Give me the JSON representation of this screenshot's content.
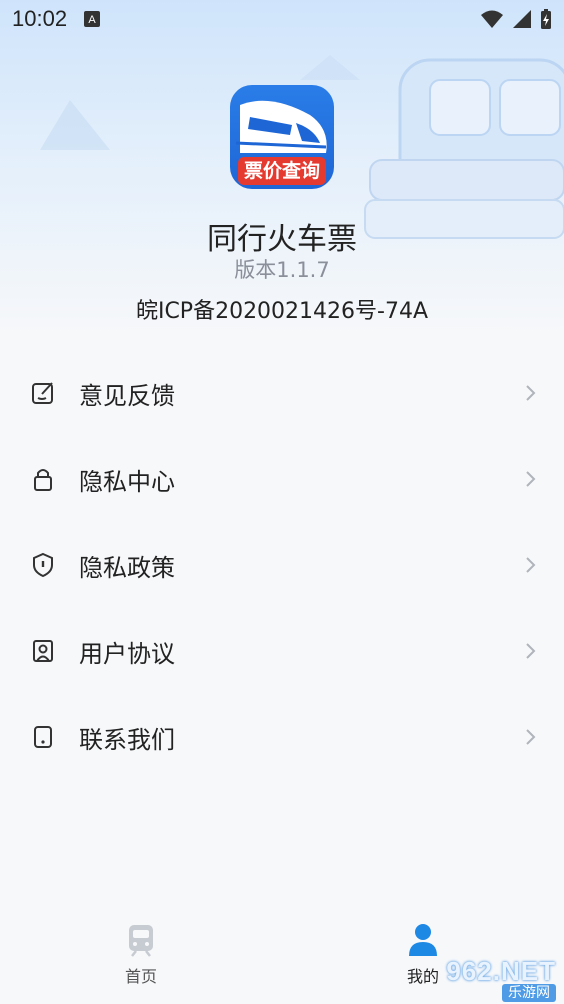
{
  "status_bar": {
    "time": "10:02",
    "notification_icon": "a-keyboard-icon",
    "icons": [
      "wifi-icon",
      "signal-icon",
      "battery-charging-icon"
    ]
  },
  "about": {
    "app_icon_text": "票价查询",
    "app_name": "同行火车票",
    "version": "版本1.1.7",
    "icp": "皖ICP备2020021426号-74A"
  },
  "menu": {
    "items": [
      {
        "label": "意见反馈",
        "icon": "feedback-edit-icon"
      },
      {
        "label": "隐私中心",
        "icon": "lock-icon"
      },
      {
        "label": "隐私政策",
        "icon": "shield-icon"
      },
      {
        "label": "用户协议",
        "icon": "agreement-person-icon"
      },
      {
        "label": "联系我们",
        "icon": "phone-icon"
      }
    ]
  },
  "tabbar": {
    "tabs": [
      {
        "label": "首页",
        "icon": "train-icon",
        "active": false
      },
      {
        "label": "我的",
        "icon": "person-icon",
        "active": true
      }
    ]
  },
  "watermark": {
    "top": "962.NET",
    "bottom": "乐游网"
  },
  "colors": {
    "accent": "#1e88e5",
    "icon_blue": "#1e66d6",
    "banner_red": "#e53a2f",
    "text_secondary": "#8a8f99"
  }
}
